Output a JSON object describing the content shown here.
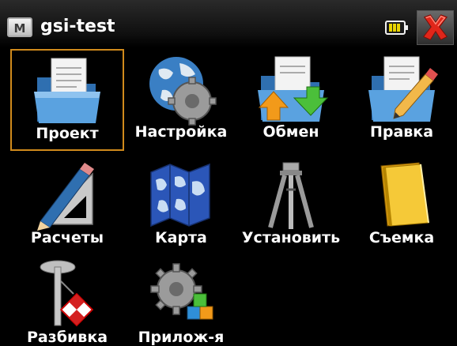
{
  "titlebar": {
    "app_icon_letter": "M",
    "title": "gsi-test",
    "battery_icon": "battery-icon",
    "close_icon": "close-icon"
  },
  "tiles": [
    {
      "label": "Проект",
      "icon": "project-folder-icon",
      "selected": true
    },
    {
      "label": "Настройка",
      "icon": "settings-globe-gear-icon"
    },
    {
      "label": "Обмен",
      "icon": "exchange-folder-arrows-icon"
    },
    {
      "label": "Правка",
      "icon": "edit-folder-pencil-icon"
    },
    {
      "label": "Расчеты",
      "icon": "calculations-pencil-ruler-icon"
    },
    {
      "label": "Карта",
      "icon": "map-icon"
    },
    {
      "label": "Установить",
      "icon": "tripod-icon"
    },
    {
      "label": "Съемка",
      "icon": "survey-notebook-icon"
    },
    {
      "label": "Разбивка",
      "icon": "stakeout-pin-icon"
    },
    {
      "label": "Прилож-я",
      "icon": "apps-gear-blocks-icon"
    }
  ],
  "colors": {
    "background": "#000000",
    "selection_border": "#d08a1c",
    "close_red": "#e0261a",
    "battery_yellow": "#e8d400"
  }
}
